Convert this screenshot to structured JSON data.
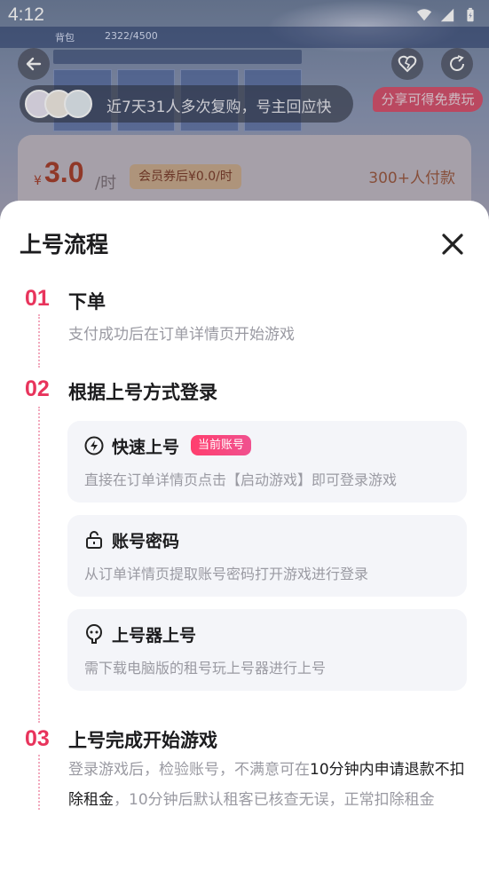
{
  "status_bar": {
    "time": "4:12"
  },
  "background": {
    "game_bar_labels": [
      "背包",
      "2322/4500"
    ],
    "notice": {
      "text": "近7天31人多次复购，号主回应快"
    },
    "share_tag": "分享可得免费玩",
    "price": {
      "currency": "¥",
      "value": "3.0",
      "unit": "/时",
      "coupon": "会员券后¥0.0/时",
      "buyers": "300+人付款"
    }
  },
  "sheet": {
    "title": "上号流程",
    "steps": [
      {
        "num": "01",
        "title": "下单",
        "desc": "支付成功后在订单详情页开始游戏"
      },
      {
        "num": "02",
        "title": "根据上号方式登录"
      },
      {
        "num": "03",
        "title": "上号完成开始游戏",
        "desc_parts": [
          "登录游戏后，检验账号，不满意可在",
          "10分钟内申请退款不扣除租金",
          "，10分钟后默认租客已核查无误，正常扣除租金"
        ]
      }
    ],
    "methods": [
      {
        "icon": "lightning-icon",
        "title": "快速上号",
        "badge": "当前账号",
        "desc": "直接在订单详情页点击【启动游戏】即可登录游戏"
      },
      {
        "icon": "lock-icon",
        "title": "账号密码",
        "desc": "从订单详情页提取账号密码打开游戏进行登录"
      },
      {
        "icon": "launcher-icon",
        "title": "上号器上号",
        "desc": "需下载电脑版的租号玩上号器进行上号"
      }
    ]
  },
  "colors": {
    "accent": "#e8345c",
    "badge_start": "#ff3e6e",
    "badge_end": "#f0518f",
    "method_bg": "#f4f5f9"
  }
}
